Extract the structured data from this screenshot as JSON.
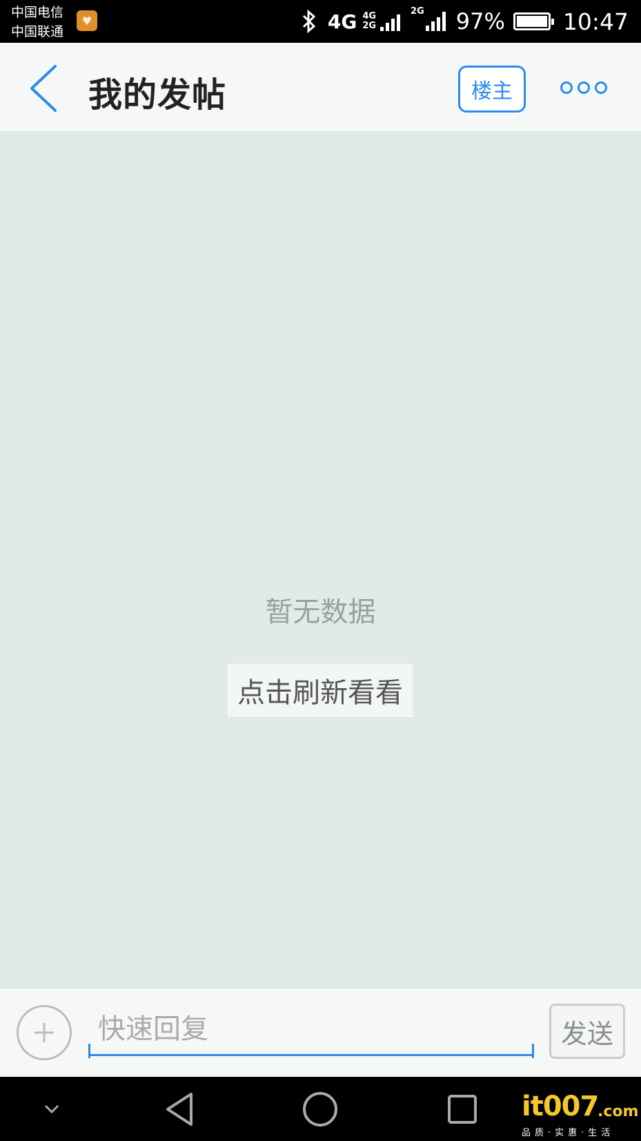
{
  "status_bar": {
    "carrier_1": "中国电信",
    "carrier_2": "中国联通",
    "network_main": "4G",
    "network_secondary_top": "4G",
    "network_secondary_bottom": "2G",
    "network_third": "2G",
    "battery_percent": "97%",
    "time": "10:47",
    "icons": [
      "app-notification-icon",
      "bluetooth-icon",
      "signal-icon",
      "battery-icon"
    ]
  },
  "header": {
    "back_icon": "chevron-left-icon",
    "title": "我的发帖",
    "owner_button": "楼主",
    "more_icon": "more-dots-icon"
  },
  "content": {
    "empty_text": "暂无数据",
    "refresh_button": "点击刷新看看"
  },
  "reply_bar": {
    "add_icon": "plus-icon",
    "input_placeholder": "快速回复",
    "input_value": "",
    "send_button": "发送"
  },
  "nav_bar": {
    "icons": [
      "collapse-icon",
      "back-triangle-icon",
      "home-circle-icon",
      "recents-square-icon"
    ]
  },
  "watermark": {
    "logo": "it007",
    "domain": ".com",
    "slogan": "品质·实惠·生活"
  },
  "colors": {
    "accent": "#2a8ce8",
    "content_bg": "#e0eae8",
    "header_bg": "#f6f8f8"
  }
}
